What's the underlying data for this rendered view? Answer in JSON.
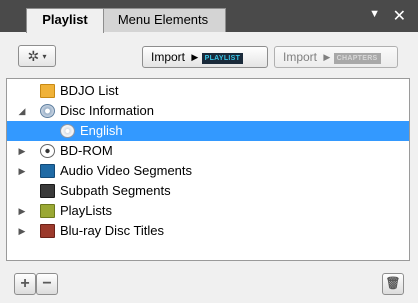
{
  "tabs": {
    "playlist": "Playlist",
    "menu_elements": "Menu Elements"
  },
  "tab_controls": {
    "menu_glyph": "▼",
    "close_glyph": "✕"
  },
  "toolbar": {
    "gear_glyph": "✲",
    "gear_caret": "▾",
    "import_playlist_label": "Import",
    "import_playlist_badge": "PLAYLIST",
    "import_chapters_label": "Import",
    "import_chapters_badge": "CHAPTERS",
    "arrow_glyph": "▶"
  },
  "tree": {
    "items": [
      {
        "label": "BDJO List",
        "icon": "folder-icon",
        "expander": ""
      },
      {
        "label": "Disc Information",
        "icon": "disc-search-icon",
        "expander": "◢"
      },
      {
        "label": "English",
        "icon": "disc-icon",
        "expander": ""
      },
      {
        "label": "BD-ROM",
        "icon": "cdrom-icon",
        "expander": "▶"
      },
      {
        "label": "Audio Video Segments",
        "icon": "book-icon",
        "expander": "▶"
      },
      {
        "label": "Subpath Segments",
        "icon": "book-icon",
        "expander": ""
      },
      {
        "label": "PlayLists",
        "icon": "book-icon",
        "expander": "▶"
      },
      {
        "label": "Blu-ray Disc Titles",
        "icon": "book-icon",
        "expander": "▶"
      }
    ]
  },
  "bottombar": {
    "add_glyph": "+",
    "remove_glyph": "−",
    "delete_glyph": "🗑"
  },
  "colors": {
    "tabstrip_bg": "#4a4a4a",
    "selection": "#3399ff",
    "panel_bg": "#f0f0f0"
  }
}
